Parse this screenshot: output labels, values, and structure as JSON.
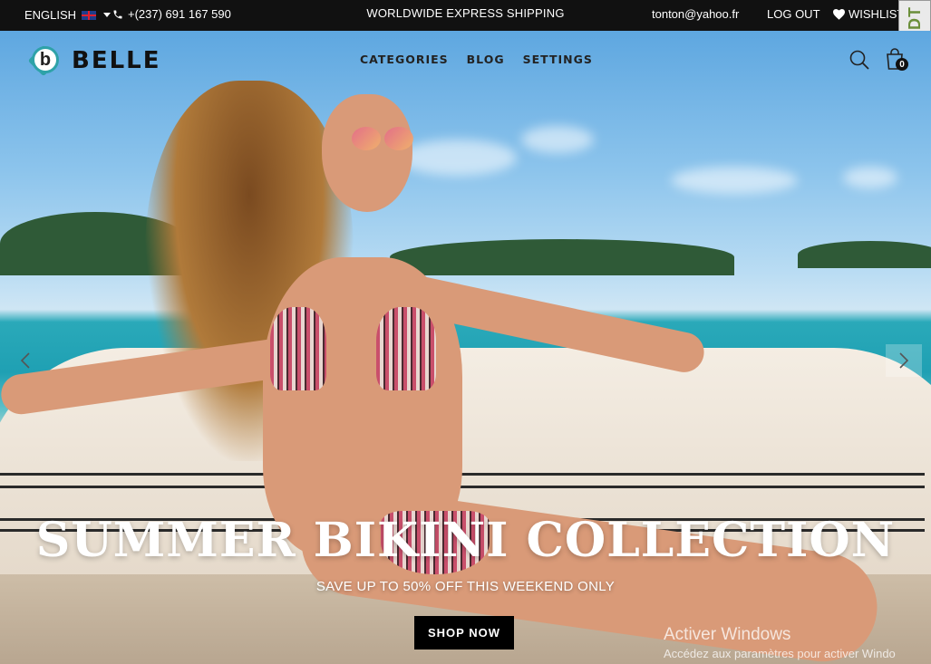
{
  "topbar": {
    "language": "ENGLISH",
    "phone": "+(237) 691 167 590",
    "shipping": "WORLDWIDE EXPRESS SHIPPING",
    "email": "tonton@yahoo.fr",
    "logout": "LOG OUT",
    "wishlist": "WISHLIST"
  },
  "debug_toolbar": {
    "label": "DJDT"
  },
  "header": {
    "brand_initial": "b",
    "brand": "BELLE",
    "nav": [
      "CATEGORIES",
      "BLOG",
      "SETTINGS"
    ],
    "cart_count": "0"
  },
  "hero": {
    "title": "SUMMER BIKINI COLLECTION",
    "subtitle": "SAVE UP TO 50% OFF THIS WEEKEND ONLY",
    "button": "SHOP NOW"
  },
  "watermark": {
    "line1": "Activer Windows",
    "line2": "Accédez aux paramètres pour activer Windo"
  },
  "colors": {
    "topbar_bg": "#111111",
    "accent": "#2ea2a8",
    "button_bg": "#000000"
  },
  "icons": [
    "phone-icon",
    "heart-icon",
    "search-icon",
    "bag-icon",
    "chevron-left-icon",
    "chevron-right-icon",
    "flag-icon",
    "caret-down-icon"
  ]
}
